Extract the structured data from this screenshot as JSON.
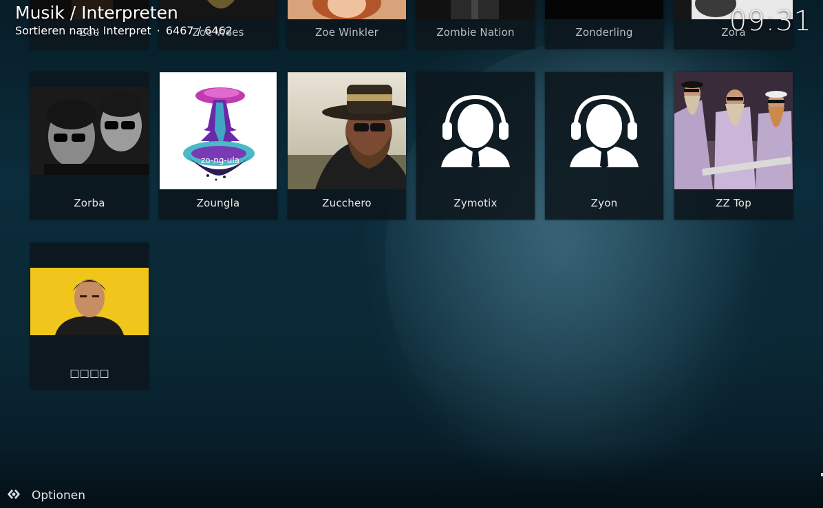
{
  "header": {
    "breadcrumb": "Musik / Interpreten",
    "sort_label": "Sortieren nach: Interpret",
    "separator": "·",
    "count": "6467 / 6462"
  },
  "clock": "09:31",
  "artists_top_row": [
    {
      "name": "Zoe"
    },
    {
      "name": "Zoe Wees"
    },
    {
      "name": "Zoe Winkler"
    },
    {
      "name": "Zombie Nation"
    },
    {
      "name": "Zonderling"
    },
    {
      "name": "Zora"
    }
  ],
  "artists_row2": [
    {
      "name": "Zorba",
      "art": "photo"
    },
    {
      "name": "Zoungla",
      "art": "photo"
    },
    {
      "name": "Zucchero",
      "art": "photo"
    },
    {
      "name": "Zymotix",
      "art": "default-artist-icon"
    },
    {
      "name": "Zyon",
      "art": "default-artist-icon"
    },
    {
      "name": "ZZ Top",
      "art": "photo"
    }
  ],
  "artists_row3": [
    {
      "name": "□□□□",
      "art": "photo"
    }
  ],
  "footer": {
    "options_label": "Optionen",
    "options_icon": "gear-icon"
  },
  "colors": {
    "background": "#0b2c3b",
    "tile": "#0c161c",
    "text": "#ffffff"
  }
}
